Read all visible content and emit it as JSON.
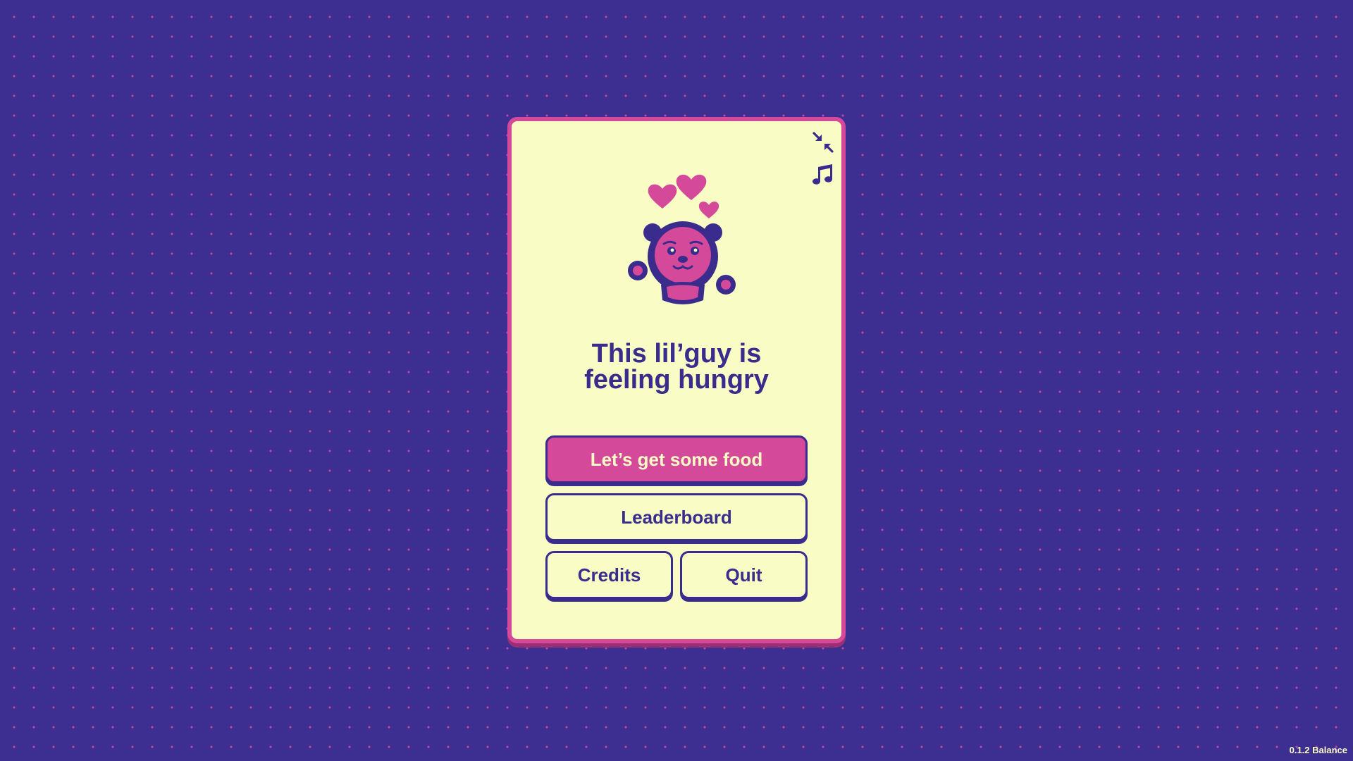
{
  "menu": {
    "title_line1": "This lil’guy is",
    "title_line2": "feeling hungry",
    "play_label": "Let’s get some food",
    "leaderboard_label": "Leaderboard",
    "credits_label": "Credits",
    "quit_label": "Quit"
  },
  "controls": {
    "fullscreen_icon": "compress-arrows-icon",
    "music_icon": "music-note-icon"
  },
  "mascot": {
    "name": "bear-with-hearts"
  },
  "version": "0.1.2 Balance",
  "colors": {
    "background": "#3d2f92",
    "dots": "#c2479a",
    "card": "#fafcc6",
    "accent": "#d4499a",
    "ink": "#3a2c8c"
  }
}
